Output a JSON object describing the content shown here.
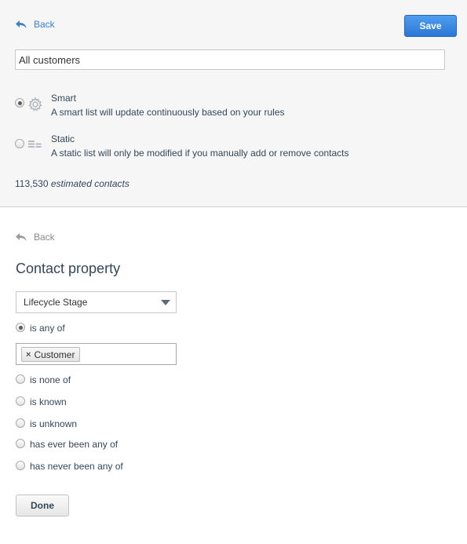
{
  "header": {
    "back_label": "Back",
    "save_label": "Save",
    "list_name": "All customers"
  },
  "list_types": [
    {
      "title": "Smart",
      "description": "A smart list will update continuously based on your rules",
      "icon": "gear-icon",
      "selected": true
    },
    {
      "title": "Static",
      "description": "A static list will only be modified if you manually add or remove contacts",
      "icon": "list-card-icon",
      "selected": false
    }
  ],
  "estimate": {
    "count": "113,530",
    "label": "estimated contacts"
  },
  "filter": {
    "back_label": "Back",
    "heading": "Contact property",
    "property_selected": "Lifecycle Stage",
    "operators": [
      {
        "label": "is any of",
        "selected": true
      },
      {
        "label": "is none of",
        "selected": false
      },
      {
        "label": "is known",
        "selected": false
      },
      {
        "label": "is unknown",
        "selected": false
      },
      {
        "label": "has ever been any of",
        "selected": false
      },
      {
        "label": "has never been any of",
        "selected": false
      }
    ],
    "values": [
      "Customer"
    ],
    "done_label": "Done"
  },
  "colors": {
    "accent": "#2a77d6",
    "link": "#3b7fd4",
    "text": "#33475b"
  }
}
